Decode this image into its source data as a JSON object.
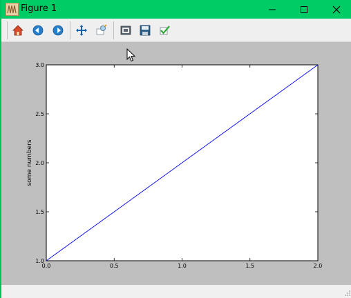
{
  "window": {
    "title": "Figure 1"
  },
  "toolbar": {
    "items": [
      "home-icon",
      "back-icon",
      "forward-icon",
      "pan-icon",
      "zoom-icon",
      "subplots-icon",
      "save-icon",
      "check-icon"
    ]
  },
  "chart_data": {
    "type": "line",
    "x": [
      0.0,
      2.0
    ],
    "series": [
      {
        "values": [
          1.0,
          3.0
        ],
        "color": "#0000ff"
      }
    ],
    "title": "",
    "xlabel": "",
    "ylabel": "some numbers",
    "xlim": [
      0.0,
      2.0
    ],
    "ylim": [
      1.0,
      3.0
    ],
    "xticks": [
      "0.0",
      "0.5",
      "1.0",
      "1.5",
      "2.0"
    ],
    "yticks": [
      "1.0",
      "1.5",
      "2.0",
      "2.5",
      "3.0"
    ],
    "grid": false
  }
}
